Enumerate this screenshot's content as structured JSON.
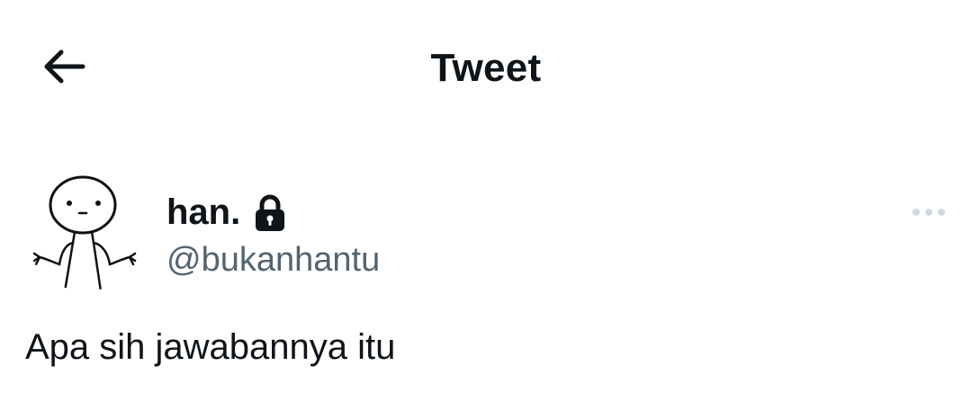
{
  "header": {
    "back_icon": "arrow-left-icon",
    "title": "Tweet"
  },
  "author": {
    "avatar_icon": "shrug-figure-avatar",
    "display_name": "han.",
    "protected_icon": "lock-icon",
    "handle": "@bukanhantu"
  },
  "menu": {
    "icon": "more-horizontal-icon"
  },
  "tweet": {
    "text": "Apa sih jawabannya itu"
  },
  "colors": {
    "text_primary": "#0f1419",
    "text_secondary": "#536471",
    "icon_muted": "#cfd9de",
    "background": "#ffffff"
  }
}
